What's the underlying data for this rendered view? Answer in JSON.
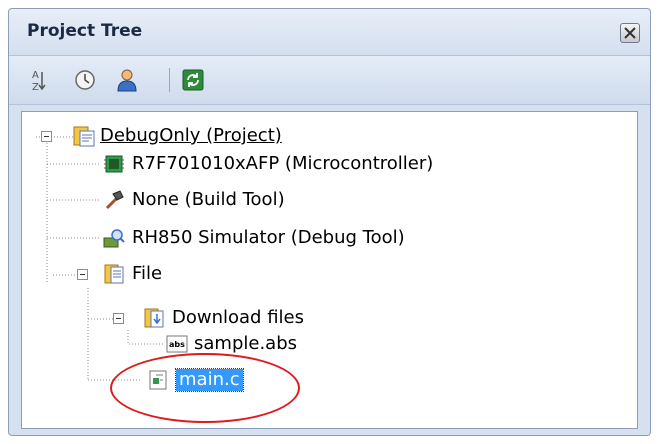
{
  "panel": {
    "title": "Project Tree"
  },
  "toolbar": {
    "buttons": [
      {
        "name": "sort-icon"
      },
      {
        "name": "clock-icon"
      },
      {
        "name": "user-icon"
      },
      {
        "name": "refresh-icon"
      }
    ]
  },
  "tree": {
    "project": "DebugOnly (Project)",
    "microcontroller": "R7F701010xAFP (Microcontroller)",
    "build_tool": "None (Build Tool)",
    "debug_tool": "RH850 Simulator (Debug Tool)",
    "file_folder": "File",
    "download_folder": "Download files",
    "download_file": "sample.abs",
    "source_file": "main.c",
    "abs_icon_text": "abs"
  },
  "colors": {
    "selection": "#3399ff",
    "highlight_circle": "#e01a1a"
  }
}
